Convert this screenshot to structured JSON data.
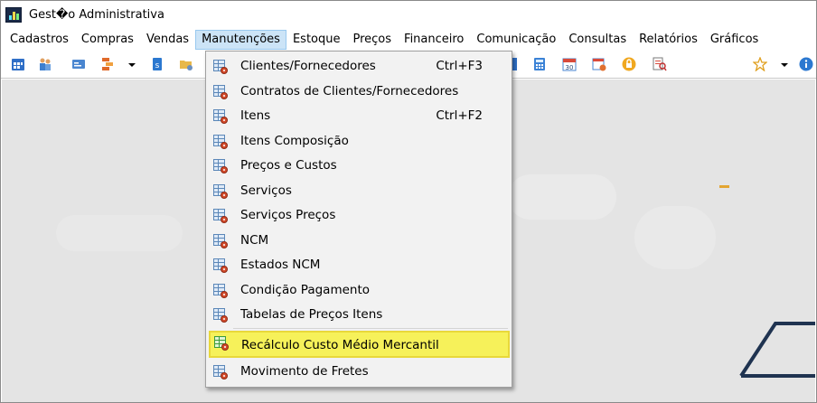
{
  "window": {
    "title": "Gest�o Administrativa"
  },
  "menubar": {
    "items": [
      {
        "label": "Cadastros"
      },
      {
        "label": "Compras"
      },
      {
        "label": "Vendas"
      },
      {
        "label": "Manutenções",
        "active": true
      },
      {
        "label": "Estoque"
      },
      {
        "label": "Preços"
      },
      {
        "label": "Financeiro"
      },
      {
        "label": "Comunicação"
      },
      {
        "label": "Consultas"
      },
      {
        "label": "Relatórios"
      },
      {
        "label": "Gráficos"
      }
    ]
  },
  "toolbar": {
    "icons": [
      "calendar-grid-icon",
      "people-icon",
      "card-icon",
      "org-chart-icon",
      "dropdown-arrow-icon",
      "phone-s-icon",
      "folder-gear-icon",
      "calculator-icon",
      "calendar-30-icon",
      "calendar-gear-icon",
      "lock-icon",
      "report-search-icon",
      "star-icon",
      "dropdown-arrow-icon",
      "info-icon"
    ]
  },
  "manutencoes_menu": {
    "items": [
      {
        "label": "Clientes/Fornecedores",
        "shortcut": "Ctrl+F3",
        "icon": "grid-gear-icon"
      },
      {
        "label": "Contratos de Clientes/Fornecedores",
        "shortcut": "",
        "icon": "grid-gear-icon"
      },
      {
        "label": "Itens",
        "shortcut": "Ctrl+F2",
        "icon": "grid-gear-icon"
      },
      {
        "label": "Itens Composição",
        "shortcut": "",
        "icon": "grid-gear-icon"
      },
      {
        "label": "Preços e Custos",
        "shortcut": "",
        "icon": "grid-gear-icon"
      },
      {
        "label": "Serviços",
        "shortcut": "",
        "icon": "grid-gear-icon"
      },
      {
        "label": "Serviços Preços",
        "shortcut": "",
        "icon": "grid-gear-icon"
      },
      {
        "label": "NCM",
        "shortcut": "",
        "icon": "grid-gear-icon"
      },
      {
        "label": "Estados NCM",
        "shortcut": "",
        "icon": "grid-gear-icon"
      },
      {
        "label": "Condição Pagamento",
        "shortcut": "",
        "icon": "grid-gear-icon"
      },
      {
        "label": "Tabelas de Preços Itens",
        "shortcut": "",
        "icon": "grid-gear-icon"
      },
      {
        "label": "Recálculo Custo Médio Mercantil",
        "shortcut": "",
        "icon": "green-grid-gear-icon",
        "highlighted": true
      },
      {
        "label": "Movimento de Fretes",
        "shortcut": "",
        "icon": "grid-gear-icon"
      }
    ]
  },
  "colors": {
    "menu_active_bg": "#cce4f7",
    "highlight": "#f6f15a",
    "workspace_bg": "#e4e4e4"
  }
}
